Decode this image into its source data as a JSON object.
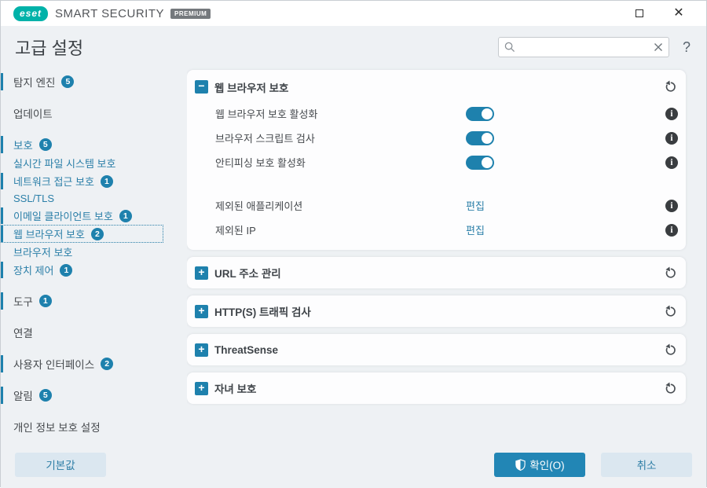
{
  "colors": {
    "accent": "#1e81ad",
    "link": "#2b7fa8",
    "ok_button": "#2286b5",
    "brand_teal": "#00b2a9"
  },
  "window": {
    "logo_text": "eset",
    "brand_name": "SMART SECURITY",
    "brand_badge": "PREMIUM",
    "maximize_icon": "maximize",
    "close_icon": "✕"
  },
  "header": {
    "title": "고급 설정",
    "search_value": "",
    "search_placeholder": "",
    "help_label": "?"
  },
  "sidebar": {
    "items": [
      {
        "label": "탐지 엔진",
        "badge": "5",
        "tone": "dark",
        "bar": true,
        "top": true,
        "selected": false
      },
      {
        "label": "업데이트",
        "badge": null,
        "tone": "dark",
        "bar": false,
        "top": true,
        "selected": false
      },
      {
        "label": "보호",
        "badge": "5",
        "tone": "blue",
        "bar": true,
        "top": true,
        "selected": false
      },
      {
        "label": "실시간 파일 시스템 보호",
        "badge": null,
        "tone": "blue",
        "bar": false,
        "top": false,
        "selected": false
      },
      {
        "label": "네트워크 접근 보호",
        "badge": "1",
        "tone": "blue",
        "bar": true,
        "top": false,
        "selected": false
      },
      {
        "label": "SSL/TLS",
        "badge": null,
        "tone": "blue",
        "bar": false,
        "top": false,
        "selected": false
      },
      {
        "label": "이메일 클라이언트 보호",
        "badge": "1",
        "tone": "blue",
        "bar": true,
        "top": false,
        "selected": false
      },
      {
        "label": "웹 브라우저 보호",
        "badge": "2",
        "tone": "blue",
        "bar": true,
        "top": false,
        "selected": true
      },
      {
        "label": "브라우저 보호",
        "badge": null,
        "tone": "blue",
        "bar": false,
        "top": false,
        "selected": false
      },
      {
        "label": "장치 제어",
        "badge": "1",
        "tone": "blue",
        "bar": true,
        "top": false,
        "selected": false
      },
      {
        "label": "도구",
        "badge": "1",
        "tone": "dark",
        "bar": true,
        "top": true,
        "selected": false
      },
      {
        "label": "연결",
        "badge": null,
        "tone": "dark",
        "bar": false,
        "top": true,
        "selected": false
      },
      {
        "label": "사용자 인터페이스",
        "badge": "2",
        "tone": "dark",
        "bar": true,
        "top": true,
        "selected": false
      },
      {
        "label": "알림",
        "badge": "5",
        "tone": "dark",
        "bar": true,
        "top": true,
        "selected": false
      },
      {
        "label": "개인 정보 보호 설정",
        "badge": null,
        "tone": "dark",
        "bar": false,
        "top": true,
        "selected": false
      }
    ]
  },
  "main": {
    "expanded_section": {
      "title": "웹 브라우저 보호",
      "collapse_icon": "−",
      "reset_icon": "undo-arrow",
      "rows": [
        {
          "label": "웹 브라우저 보호 활성화",
          "control": "toggle",
          "state": "on",
          "info": true
        },
        {
          "label": "브라우저 스크립트 검사",
          "control": "toggle",
          "state": "on",
          "info": true
        },
        {
          "label": "안티피싱 보호 활성화",
          "control": "toggle",
          "state": "on",
          "info": true
        },
        {
          "label": "제외된 애플리케이션",
          "control": "link",
          "link_label": "편집",
          "info": true
        },
        {
          "label": "제외된 IP",
          "control": "link",
          "link_label": "편집",
          "info": true
        }
      ]
    },
    "collapsed_sections": [
      {
        "title": "URL 주소 관리",
        "expand_icon": "+",
        "modified": true
      },
      {
        "title": "HTTP(S) 트래픽 검사",
        "expand_icon": "+",
        "modified": false
      },
      {
        "title": "ThreatSense",
        "expand_icon": "+",
        "modified": false
      },
      {
        "title": "자녀 보호",
        "expand_icon": "+",
        "modified": true
      }
    ]
  },
  "footer": {
    "default_label": "기본값",
    "ok_label": "확인(O)",
    "cancel_label": "취소"
  }
}
